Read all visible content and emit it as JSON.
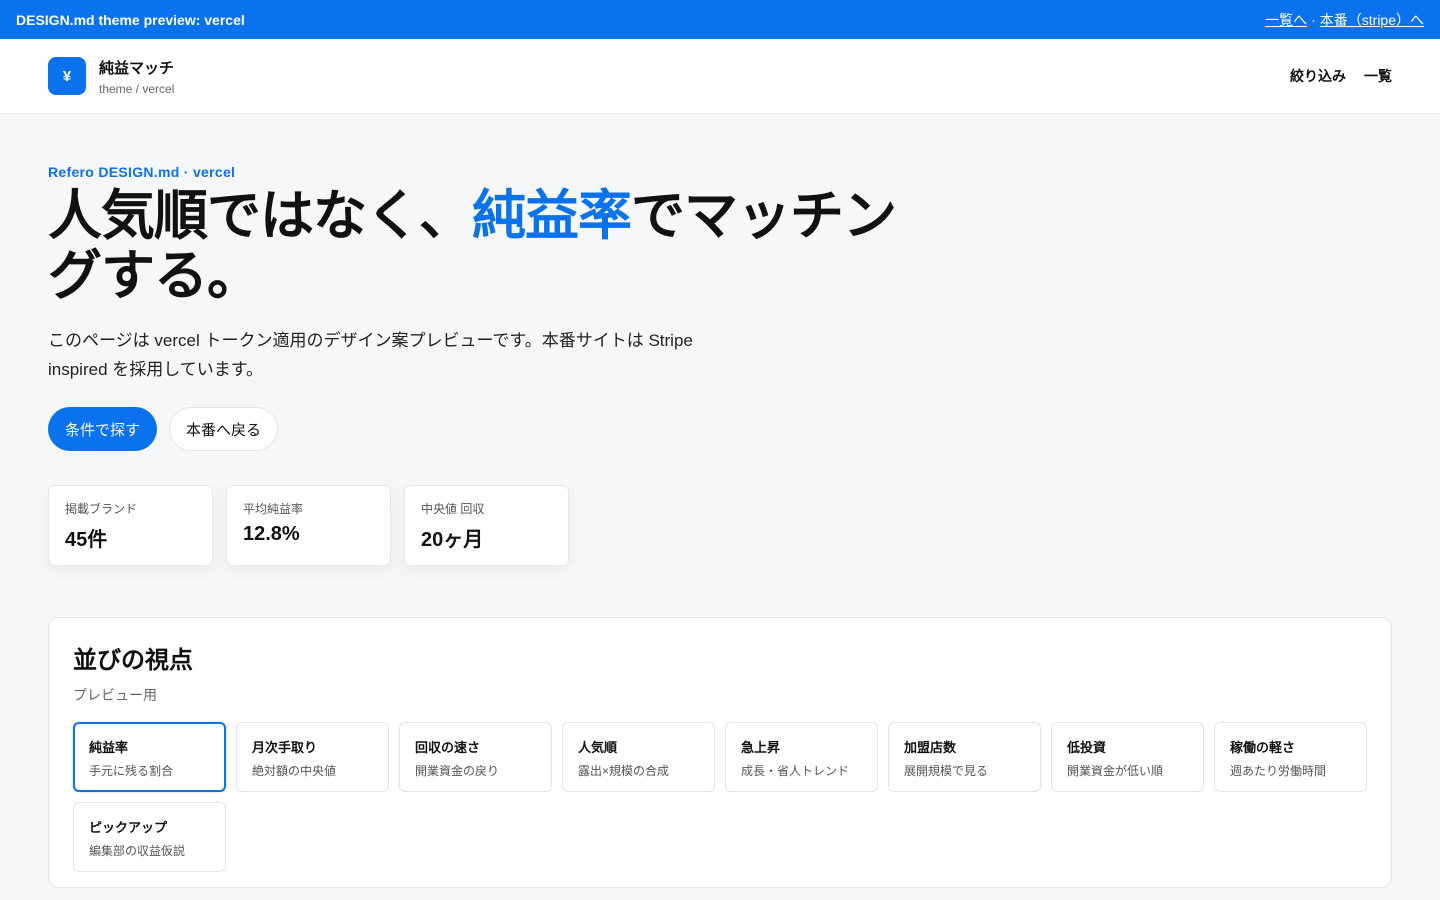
{
  "topbar": {
    "title": "DESIGN.md theme preview: vercel",
    "link_list": "一覧へ",
    "separator": "·",
    "link_prod": "本番（stripe）へ"
  },
  "header": {
    "logo_glyph": "¥",
    "brand_name": "純益マッチ",
    "brand_sub": "theme / vercel",
    "nav": [
      "絞り込み",
      "一覧"
    ]
  },
  "hero": {
    "eyebrow": "Refero DESIGN.md · vercel",
    "headline_before": "人気順ではなく、",
    "headline_accent": "純益率",
    "headline_after": "でマッチングする。",
    "lead": "このページは vercel トークン適用のデザイン案プレビューです。本番サイトは Stripe inspired を採用しています。",
    "primary_button": "条件で探す",
    "secondary_button": "本番へ戻る"
  },
  "stats": [
    {
      "label": "掲載ブランド",
      "value": "45件"
    },
    {
      "label": "平均純益率",
      "value": "12.8%"
    },
    {
      "label": "中央値 回収",
      "value": "20ヶ月"
    }
  ],
  "panel": {
    "title": "並びの視点",
    "subtitle": "プレビュー用",
    "options": [
      {
        "title": "純益率",
        "desc": "手元に残る割合",
        "active": true
      },
      {
        "title": "月次手取り",
        "desc": "絶対額の中央値"
      },
      {
        "title": "回収の速さ",
        "desc": "開業資金の戻り"
      },
      {
        "title": "人気順",
        "desc": "露出×規模の合成"
      },
      {
        "title": "急上昇",
        "desc": "成長・省人トレンド"
      },
      {
        "title": "加盟店数",
        "desc": "展開規模で見る"
      },
      {
        "title": "低投資",
        "desc": "開業資金が低い順"
      },
      {
        "title": "稼働の軽さ",
        "desc": "週あたり労働時間"
      },
      {
        "title": "ピックアップ",
        "desc": "編集部の収益仮説"
      }
    ]
  },
  "colors": {
    "accent": "#0a72ec",
    "background": "#f6f7f9"
  }
}
